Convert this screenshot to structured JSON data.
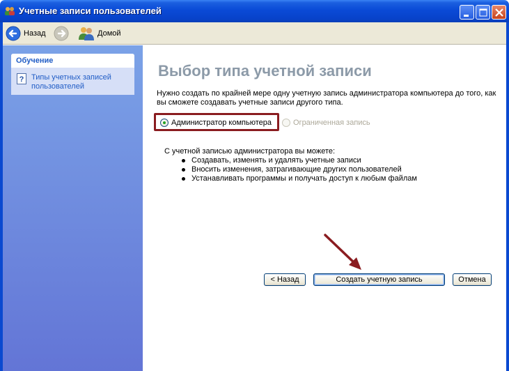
{
  "window": {
    "title": "Учетные записи пользователей",
    "controls": [
      "minimize",
      "maximize",
      "close"
    ]
  },
  "toolbar": {
    "back_label": "Назад",
    "home_label": "Домой"
  },
  "sidebar": {
    "header": "Обучение",
    "items": [
      {
        "label": "Типы учетных записей пользователей",
        "icon": "help-icon"
      }
    ]
  },
  "main": {
    "heading": "Выбор типа учетной записи",
    "description": "Нужно создать по крайней мере одну учетную запись администратора компьютера до того, как вы сможете создавать учетные записи другого типа.",
    "account_types": [
      {
        "label": "Администратор компьютера",
        "selected": true,
        "enabled": true
      },
      {
        "label": "Ограниченная запись",
        "selected": false,
        "enabled": false
      }
    ],
    "info_title": "С учетной записью администратора вы можете:",
    "bullets": [
      "Создавать, изменять и удалять учетные записи",
      "Вносить изменения, затрагивающие других пользователей",
      "Устанавливать программы и получать доступ к любым файлам"
    ],
    "buttons": {
      "back": "< Назад",
      "create": "Создать учетную запись",
      "cancel": "Отмена"
    }
  },
  "colors": {
    "title_bar": "#0a4ad6",
    "sidebar_bg": "#7ba2e7",
    "heading": "#8c9aa8",
    "highlight_border": "#8a1c20",
    "arrow": "#8a1c20",
    "link": "#215dc6"
  }
}
